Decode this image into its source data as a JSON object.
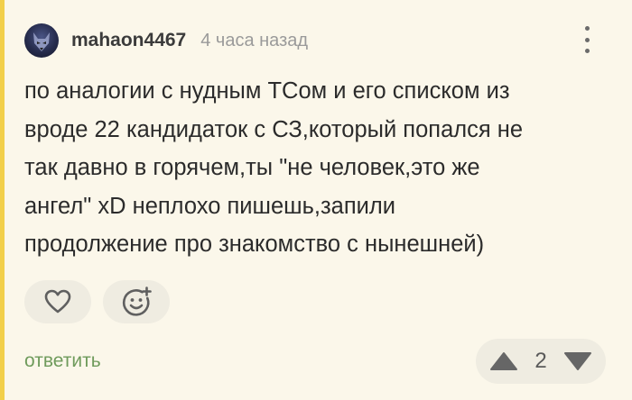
{
  "comment": {
    "author": "mahaon4467",
    "time": "4 часа назад",
    "lines": [
      "по аналогии с нудным ТСом и его списком из",
      "вроде 22 кандидаток с СЗ,который попался не",
      "так давно в горячем,ты \"не человек,это же",
      "ангел\" xD неплохо пишешь,запили",
      "продолжение про знакомство с нынешней)"
    ],
    "reply_label": "ответить",
    "rating": "2"
  },
  "icons": {
    "avatar": "wolf-avatar",
    "menu": "more-vertical-icon",
    "like": "heart-icon",
    "react": "add-emoji-icon",
    "upvote": "triangle-up-icon",
    "downvote": "triangle-down-icon"
  },
  "colors": {
    "background": "#fbf7ea",
    "thread_line": "#f2cf4a",
    "reply": "#6f9b5c",
    "pill": "#efece1"
  }
}
